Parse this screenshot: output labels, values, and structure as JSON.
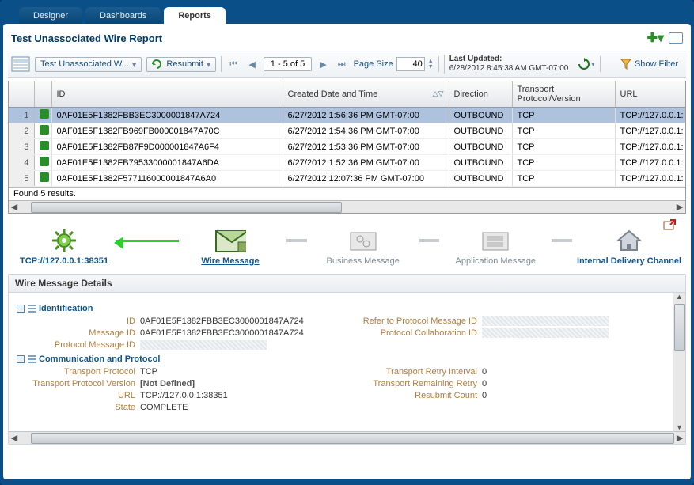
{
  "tabs": {
    "designer": "Designer",
    "dashboards": "Dashboards",
    "reports": "Reports"
  },
  "report": {
    "title": "Test Unassociated Wire Report"
  },
  "toolbar": {
    "breadcrumb": "Test Unassociated W...",
    "resubmit": "Resubmit",
    "pager": "1 - 5 of 5",
    "page_size_label": "Page Size",
    "page_size_value": "40",
    "last_updated_label": "Last Updated:",
    "last_updated_value": "6/28/2012 8:45:38 AM GMT-07:00",
    "show_filter": "Show Filter"
  },
  "columns": {
    "id": "ID",
    "created": "Created Date and Time",
    "direction": "Direction",
    "transport": "Transport Protocol/Version",
    "url": "URL"
  },
  "rows": [
    {
      "n": "1",
      "id": "0AF01E5F1382FBB3EC3000001847A724",
      "created": "6/27/2012 1:56:36 PM GMT-07:00",
      "direction": "OUTBOUND",
      "transport": "TCP",
      "url": "TCP://127.0.0.1:"
    },
    {
      "n": "2",
      "id": "0AF01E5F1382FB969FB000001847A70C",
      "created": "6/27/2012 1:54:36 PM GMT-07:00",
      "direction": "OUTBOUND",
      "transport": "TCP",
      "url": "TCP://127.0.0.1:"
    },
    {
      "n": "3",
      "id": "0AF01E5F1382FB87F9D000001847A6F4",
      "created": "6/27/2012 1:53:36 PM GMT-07:00",
      "direction": "OUTBOUND",
      "transport": "TCP",
      "url": "TCP://127.0.0.1:"
    },
    {
      "n": "4",
      "id": "0AF01E5F1382FB79533000001847A6DA",
      "created": "6/27/2012 1:52:36 PM GMT-07:00",
      "direction": "OUTBOUND",
      "transport": "TCP",
      "url": "TCP://127.0.0.1:"
    },
    {
      "n": "5",
      "id": "0AF01E5F1382F577116000001847A6A0",
      "created": "6/27/2012 12:07:36 PM GMT-07:00",
      "direction": "OUTBOUND",
      "transport": "TCP",
      "url": "TCP://127.0.0.1:"
    }
  ],
  "results_status": "Found 5 results.",
  "flow": {
    "endpoint": "TCP://127.0.0.1:38351",
    "wire": "Wire Message",
    "business": "Business Message",
    "application": "Application Message",
    "internal": "Internal Delivery Channel"
  },
  "details": {
    "title": "Wire Message Details",
    "identification": {
      "heading": "Identification",
      "id_k": "ID",
      "id_v": "0AF01E5F1382FBB3EC3000001847A724",
      "msgid_k": "Message ID",
      "msgid_v": "0AF01E5F1382FBB3EC3000001847A724",
      "pmid_k": "Protocol Message ID",
      "ref_pmid_k": "Refer to Protocol Message ID",
      "collab_k": "Protocol Collaboration ID"
    },
    "comm": {
      "heading": "Communication and Protocol",
      "tp_k": "Transport Protocol",
      "tp_v": "TCP",
      "tpv_k": "Transport Protocol Version",
      "tpv_v": "[Not Defined]",
      "url_k": "URL",
      "url_v": "TCP://127.0.0.1:38351",
      "state_k": "State",
      "state_v": "COMPLETE",
      "tri_k": "Transport Retry Interval",
      "tri_v": "0",
      "trr_k": "Transport Remaining Retry",
      "trr_v": "0",
      "rc_k": "Resubmit Count",
      "rc_v": "0"
    }
  }
}
